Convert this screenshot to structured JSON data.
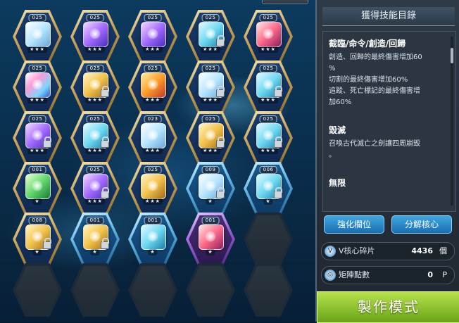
{
  "grid": {
    "cores": [
      {
        "level": "025",
        "color": "gold",
        "skill": "ghost",
        "locked": false,
        "stars": "★★★"
      },
      {
        "level": "025",
        "color": "gold",
        "skill": "purple",
        "locked": false,
        "stars": "★★★"
      },
      {
        "level": "025",
        "color": "gold",
        "skill": "purple",
        "locked": false,
        "stars": "★★★"
      },
      {
        "level": "025",
        "color": "gold",
        "skill": "teal",
        "locked": true,
        "stars": "★★★"
      },
      {
        "level": "025",
        "color": "gold",
        "skill": "red",
        "locked": false,
        "stars": "★★★"
      },
      {
        "level": "025",
        "color": "gold",
        "skill": "multi",
        "locked": false,
        "stars": "★★★"
      },
      {
        "level": "025",
        "color": "gold",
        "skill": "gold",
        "locked": true,
        "stars": "★★★"
      },
      {
        "level": "025",
        "color": "gold",
        "skill": "orange",
        "locked": false,
        "stars": "★★★"
      },
      {
        "level": "025",
        "color": "gold",
        "skill": "ghost",
        "locked": true,
        "stars": "★★★"
      },
      {
        "level": "025",
        "color": "gold",
        "skill": "teal",
        "locked": true,
        "stars": "★★★"
      },
      {
        "level": "025",
        "color": "gold",
        "skill": "purple",
        "locked": true,
        "stars": "★★★"
      },
      {
        "level": "025",
        "color": "gold",
        "skill": "teal",
        "locked": true,
        "stars": "★★★"
      },
      {
        "level": "023",
        "color": "gold",
        "skill": "ghost",
        "locked": false,
        "stars": "★★★"
      },
      {
        "level": "025",
        "color": "gold",
        "skill": "gold",
        "locked": true,
        "stars": "★★★"
      },
      {
        "level": "025",
        "color": "gold",
        "skill": "teal",
        "locked": true,
        "stars": "★★★"
      },
      {
        "level": "001",
        "color": "gold",
        "skill": "green",
        "locked": false,
        "stars": "★"
      },
      {
        "level": "025",
        "color": "gold",
        "skill": "purple",
        "locked": true,
        "stars": "★★★"
      },
      {
        "level": "025",
        "color": "gold",
        "skill": "gold",
        "locked": false,
        "stars": "★★★"
      },
      {
        "level": "009",
        "color": "blue",
        "skill": "ghost",
        "locked": true,
        "stars": "★"
      },
      {
        "level": "006",
        "color": "blue",
        "skill": "teal",
        "locked": true,
        "stars": "★"
      },
      {
        "level": "008",
        "color": "gold",
        "skill": "gold",
        "locked": true,
        "stars": "★"
      },
      {
        "level": "001",
        "color": "blue",
        "skill": "gold",
        "locked": true,
        "stars": "★"
      },
      {
        "level": "001",
        "color": "blue",
        "skill": "teal",
        "locked": false,
        "stars": "★"
      },
      {
        "level": "001",
        "color": "purple",
        "skill": "red",
        "locked": false,
        "stars": "★"
      },
      {
        "level": "",
        "color": "empty",
        "skill": "",
        "locked": false,
        "stars": ""
      },
      {
        "level": "",
        "color": "empty",
        "skill": "",
        "locked": false,
        "stars": ""
      },
      {
        "level": "",
        "color": "empty",
        "skill": "",
        "locked": false,
        "stars": ""
      },
      {
        "level": "",
        "color": "empty",
        "skill": "",
        "locked": false,
        "stars": ""
      },
      {
        "level": "",
        "color": "empty",
        "skill": "",
        "locked": false,
        "stars": ""
      },
      {
        "level": "",
        "color": "empty",
        "skill": "",
        "locked": false,
        "stars": ""
      }
    ]
  },
  "panel": {
    "title": "獲得技能目錄",
    "skills": [
      {
        "name": "截臨/命令/創造/回歸",
        "desc": "創造、回歸的最終傷害增加60\n%\n切割的最終傷害增加60%\n追蹤、死亡標記的最終傷害增\n加60%"
      },
      {
        "name": "毀滅",
        "desc": "召喚古代滅亡之劍讓四周崩毀\n。"
      },
      {
        "name": "無限",
        "desc": ""
      }
    ]
  },
  "buttons": {
    "enhance": "強化欄位",
    "disassemble": "分解核心",
    "craft": "製作模式"
  },
  "stats": {
    "shards": {
      "label": "V核心碎片",
      "value": "4436",
      "unit": "個",
      "icon": "v-core-icon"
    },
    "matrix": {
      "label": "矩陣點數",
      "value": "0",
      "unit": "P",
      "icon": "matrix-point-icon"
    }
  }
}
